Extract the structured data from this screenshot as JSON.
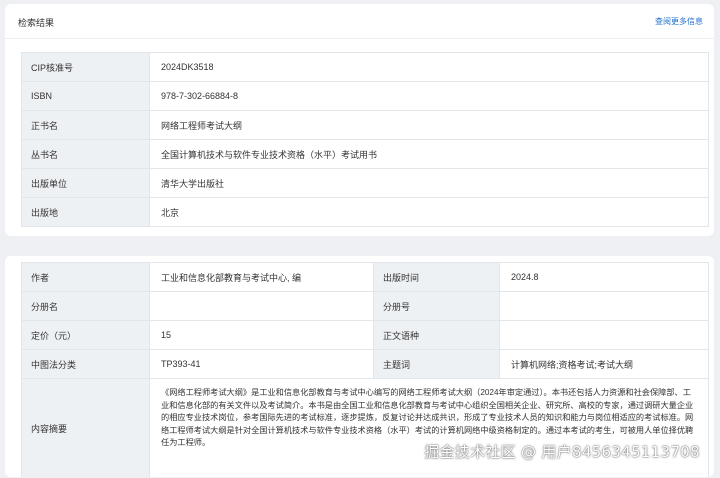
{
  "header": {
    "title": "检索结果",
    "more_link": "查阅更多信息"
  },
  "basic_info": [
    {
      "label": "CIP核准号",
      "value": "2024DK3518"
    },
    {
      "label": "ISBN",
      "value": "978-7-302-66884-8"
    },
    {
      "label": "正书名",
      "value": "网络工程师考试大纲"
    },
    {
      "label": "丛书名",
      "value": "全国计算机技术与软件专业技术资格（水平）考试用书"
    },
    {
      "label": "出版单位",
      "value": "清华大学出版社"
    },
    {
      "label": "出版地",
      "value": "北京"
    }
  ],
  "details": {
    "author_label": "作者",
    "author_value": "工业和信息化部教育与考试中心, 编",
    "pubtime_label": "出版时间",
    "pubtime_value": "2024.8",
    "volname_label": "分册名",
    "volname_value": "",
    "volnum_label": "分册号",
    "volnum_value": "",
    "price_label": "定价（元）",
    "price_value": "15",
    "lang_label": "正文语种",
    "lang_value": "",
    "clc_label": "中图法分类",
    "clc_value": "TP393-41",
    "subject_label": "主题词",
    "subject_value": "计算机网络;资格考试;考试大纲",
    "abstract_label": "内容摘要",
    "abstract_value": "《网络工程师考试大纲》是工业和信息化部教育与考试中心编写的网络工程师考试大纲（2024年审定通过）。本书还包括人力资源和社会保障部、工业和信息化部的有关文件以及考试简介。本书是由全国工业和信息化部教育与考试中心组织全国相关企业、研究所、高校的专家，通过调研大量企业的相应专业技术岗位，参考国际先进的考试标准，逐步提炼，反复讨论并达成共识，形成了专业技术人员的知识和能力与岗位相适应的考试标准。网络工程师考试大纲是针对全国计算机技术与软件专业技术资格（水平）考试的计算机网络中级资格制定的。通过本考试的考生，可被用人单位择优聘任为工程师。"
  },
  "watermark": "掘金技术社区 @ 用户8456345113708"
}
